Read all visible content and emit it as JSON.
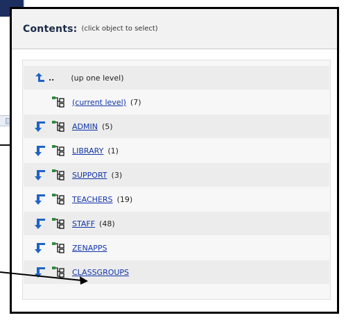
{
  "panel": {
    "title": "Contents:",
    "hint": "(click object to select)"
  },
  "up_row": {
    "dots": "..",
    "label": "(up one level)"
  },
  "current_row": {
    "label": "(current level)",
    "count": "(7)"
  },
  "items": [
    {
      "name": "ADMIN",
      "count": "(5)"
    },
    {
      "name": "LIBRARY",
      "count": "(1)"
    },
    {
      "name": "SUPPORT",
      "count": "(3)"
    },
    {
      "name": "TEACHERS",
      "count": "(19)"
    },
    {
      "name": "STAFF",
      "count": "(48)"
    },
    {
      "name": "ZENAPPS",
      "count": ""
    },
    {
      "name": "CLASSGROUPS",
      "count": ""
    }
  ],
  "colors": {
    "link": "#1033a8",
    "arrow_icon": "#1f63c5",
    "tree_icon": "#2f8a3c",
    "header_bg": "#f2f2f2",
    "row_alt": "#ececec"
  },
  "icons": {
    "up": "up-level-arrow-icon",
    "drill": "drill-down-arrow-icon",
    "container": "container-tree-icon"
  }
}
